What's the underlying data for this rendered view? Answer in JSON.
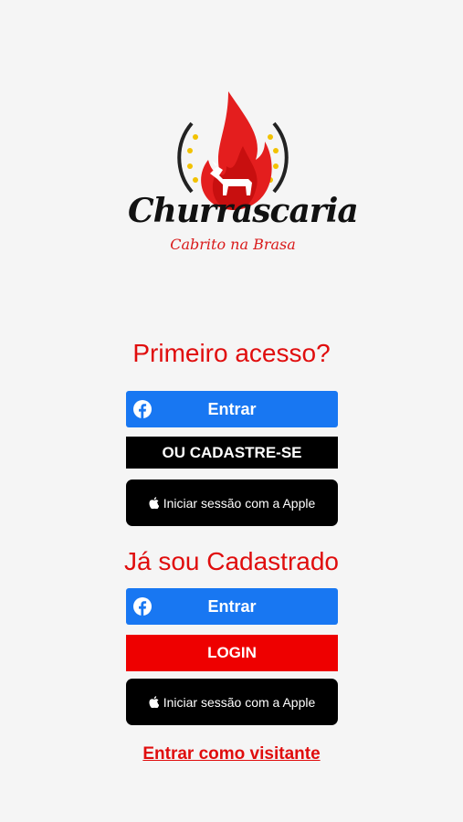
{
  "logo": {
    "title": "Churrascaria",
    "subtitle": "Cabrito na Brasa",
    "brand_color": "#e00d0d"
  },
  "first_access": {
    "heading": "Primeiro acesso?",
    "facebook_label": "Entrar",
    "register_label": "OU CADASTRE-SE",
    "apple_label": "Iniciar sessão com a Apple"
  },
  "registered": {
    "heading": "Já sou Cadastrado",
    "facebook_label": "Entrar",
    "login_label": "LOGIN",
    "apple_label": "Iniciar sessão com a Apple"
  },
  "guest_link": "Entrar como visitante",
  "colors": {
    "facebook": "#1877f2",
    "login": "#ee0000",
    "apple": "#000000",
    "heading": "#e00d0d"
  },
  "icons": {
    "facebook": "facebook-icon",
    "apple": "apple-icon"
  }
}
